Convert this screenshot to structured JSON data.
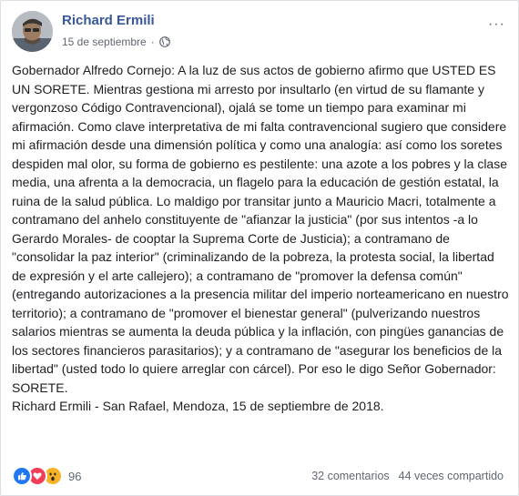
{
  "post": {
    "author": "Richard Ermili",
    "date": "15 de septiembre",
    "separator": "·",
    "privacy_icon": "globe-icon",
    "more_icon": "ellipsis-icon",
    "more_glyph": "···",
    "paragraphs": [
      "Gobernador Alfredo Cornejo: A la luz de sus actos de gobierno afirmo que USTED ES UN SORETE. Mientras gestiona mi arresto por insultarlo (en virtud de su flamante y vergonzoso Código Contravencional), ojalá se tome un tiempo para examinar mi afirmación. Como clave interpretativa de mi falta contravencional sugiero que considere mi afirmación desde una dimensión política y como una analogía: así como los soretes despiden mal olor, su forma de gobierno es pestilente: una azote a los pobres y la clase media, una afrenta a la democracia, un flagelo para la educación de gestión estatal, la ruina de la salud pública. Lo maldigo por transitar junto a Mauricio Macri, totalmente a contramano del anhelo constituyente de \"afianzar la justicia\" (por sus intentos -a lo Gerardo Morales- de cooptar la Suprema Corte de Justicia); a contramano de \"consolidar la paz interior\" (criminalizando de la pobreza, la protesta social, la libertad de expresión y el arte callejero); a contramano de \"promover la defensa común\" (entregando autorizaciones a la presencia militar del imperio norteamericano en nuestro territorio); a contramano de \"promover el bienestar general\" (pulverizando nuestros salarios mientras se aumenta la deuda pública y la inflación, con pingües ganancias de los sectores financieros parasitarios); y a contramano de \"asegurar los beneficios de la libertad\" (usted todo lo quiere arreglar con cárcel). Por eso le digo Señor Gobernador: SORETE.",
      "Richard Ermili - San Rafael, Mendoza, 15 de septiembre de 2018."
    ]
  },
  "footer": {
    "reactions": [
      {
        "name": "like",
        "color": "#2078f4"
      },
      {
        "name": "love",
        "color": "#f33e58"
      },
      {
        "name": "wow",
        "color": "#f7b125"
      }
    ],
    "reaction_count": "96",
    "comments": "32 comentarios",
    "shares": "44 veces compartido"
  }
}
